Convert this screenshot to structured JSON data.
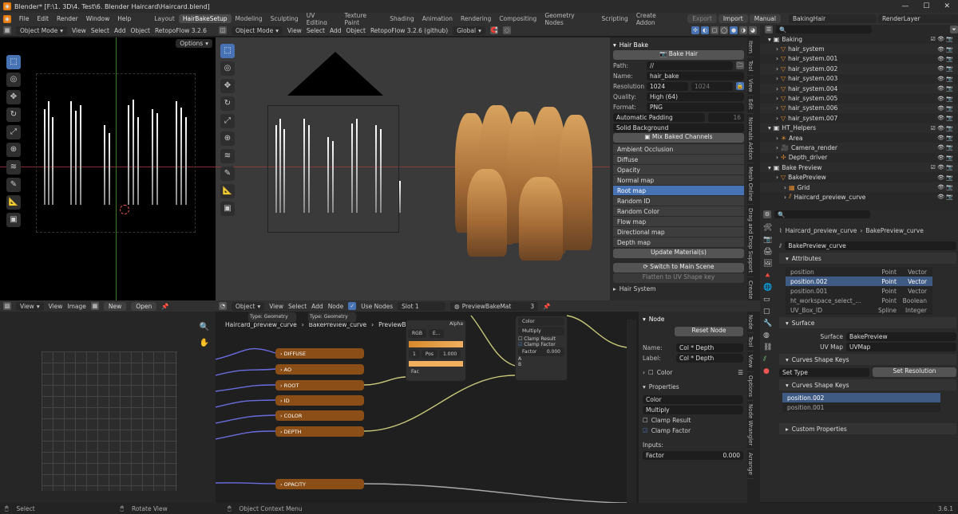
{
  "titlebar": {
    "title": "Blender* [F:\\1. 3D\\4. Test\\6. Blender Haircard\\Haircard.blend]"
  },
  "menu": {
    "items": [
      "File",
      "Edit",
      "Render",
      "Window",
      "Help"
    ],
    "workspaces": [
      "Layout",
      "HairBakeSetup",
      "Modeling",
      "Sculpting",
      "UV Editing",
      "Texture Paint",
      "Shading",
      "Animation",
      "Rendering",
      "Compositing",
      "Geometry Nodes",
      "Scripting",
      "Create Addon"
    ],
    "active_workspace": "HairBakeSetup",
    "export": "Export",
    "import": "Import",
    "manual": "Manual",
    "scene": "BakingHair",
    "view_layer": "RenderLayer"
  },
  "uv_header": {
    "mode": "Object Mode",
    "view": "View",
    "select": "Select",
    "add": "Add",
    "object": "Object",
    "addon": "RetopoFlow 3.2.6",
    "options": "Options"
  },
  "v3d_header": {
    "mode": "Object Mode",
    "view": "View",
    "select": "Select",
    "add": "Add",
    "object": "Object",
    "addon": "RetopoFlow 3.2.6 (github)",
    "orientation": "Global"
  },
  "hair_bake": {
    "panel_title": "Hair Bake",
    "bake_button": "Bake Hair",
    "path_label": "Path:",
    "path_value": "//",
    "name_label": "Name:",
    "name_value": "hair_bake",
    "resolution_label": "Resolution",
    "res_x": "1024",
    "res_y": "1024",
    "quality_label": "Quality:",
    "quality_value": "High (64)",
    "format_label": "Format:",
    "format_value": "PNG",
    "padding_label": "Automatic Padding",
    "padding_value": "16",
    "background": "Solid Background",
    "mix_button": "Mix Baked Channels",
    "channels": [
      "Ambient Occlusion",
      "Diffuse",
      "Opacity",
      "Normal map",
      "Root map",
      "Random ID",
      "Random Color",
      "Flow map",
      "Directional map",
      "Depth map"
    ],
    "selected_channel": "Root map",
    "update_button": "Update Material(s)",
    "switch_button": "Switch to Main Scene",
    "flatten_button": "Flatten to UV Shape key",
    "hair_system": "Hair System"
  },
  "side_tabs": [
    "Item",
    "Tool",
    "View",
    "Edit",
    "Normals Addon",
    "Mesh Online",
    "Drag and Drop Support",
    "Create"
  ],
  "node_side_tabs": [
    "Node",
    "Tool",
    "View",
    "Options",
    "Node Wrangler",
    "Arrange"
  ],
  "outliner": {
    "search_placeholder": "",
    "rows": [
      {
        "label": "Baking",
        "indent": 1,
        "kind": "collection"
      },
      {
        "label": "hair_system",
        "indent": 2,
        "kind": "object"
      },
      {
        "label": "hair_system.001",
        "indent": 2,
        "kind": "object"
      },
      {
        "label": "hair_system.002",
        "indent": 2,
        "kind": "object"
      },
      {
        "label": "hair_system.003",
        "indent": 2,
        "kind": "object"
      },
      {
        "label": "hair_system.004",
        "indent": 2,
        "kind": "object"
      },
      {
        "label": "hair_system.005",
        "indent": 2,
        "kind": "object"
      },
      {
        "label": "hair_system.006",
        "indent": 2,
        "kind": "object"
      },
      {
        "label": "hair_system.007",
        "indent": 2,
        "kind": "object"
      },
      {
        "label": "HT_Helpers",
        "indent": 1,
        "kind": "collection"
      },
      {
        "label": "Area",
        "indent": 2,
        "kind": "light"
      },
      {
        "label": "Camera_render",
        "indent": 2,
        "kind": "camera"
      },
      {
        "label": "Depth_driver",
        "indent": 2,
        "kind": "empty"
      },
      {
        "label": "Bake Preview",
        "indent": 1,
        "kind": "collection"
      },
      {
        "label": "BakePreview",
        "indent": 2,
        "kind": "object"
      },
      {
        "label": "Grid",
        "indent": 3,
        "kind": "mesh"
      },
      {
        "label": "Haircard_preview_curve",
        "indent": 3,
        "kind": "curve"
      }
    ]
  },
  "properties": {
    "breadcrumb_obj": "Haircard_preview_curve",
    "breadcrumb_data": "BakePreview_curve",
    "data_name": "BakePreview_curve",
    "attributes_title": "Attributes",
    "attributes": [
      {
        "name": "position",
        "domain": "Point",
        "type": "Vector"
      },
      {
        "name": "position.002",
        "domain": "Point",
        "type": "Vector"
      },
      {
        "name": "position.001",
        "domain": "Point",
        "type": "Vector"
      },
      {
        "name": "ht_workspace_select_...",
        "domain": "Point",
        "type": "Boolean"
      },
      {
        "name": "UV_Box_ID",
        "domain": "Spline",
        "type": "Integer"
      }
    ],
    "surface_title": "Surface",
    "surface_label": "Surface",
    "surface_value": "BakePreview",
    "uvmap_label": "UV Map",
    "uvmap_value": "UVMap",
    "shape_keys_title": "Curves Shape Keys",
    "set_type": "Set Type",
    "set_resolution": "Set Resolution",
    "shape_keys_title2": "Curves Shape Keys",
    "shape_keys": [
      "position.002",
      "position.001"
    ],
    "custom_props": "Custom Properties"
  },
  "image_editor": {
    "view": "View",
    "view2": "View",
    "image": "Image",
    "new": "New",
    "open": "Open"
  },
  "node_header": {
    "object": "Object",
    "view": "View",
    "select": "Select",
    "add": "Add",
    "node": "Node",
    "use_nodes": "Use Nodes",
    "slot": "Slot 1",
    "material": "PreviewBakeMat",
    "users": "3"
  },
  "node_breadcrumb": [
    "Haircard_preview_curve",
    "BakePreview_curve",
    "PreviewBakeMat"
  ],
  "nodes": {
    "attr_nodes": [
      "DIFFUSE",
      "AO",
      "ROOT",
      "ID",
      "COLOR",
      "DEPTH",
      "OPACITY"
    ],
    "type_label": "Type:",
    "type_value": "Geometry",
    "alpha": "Alpha",
    "ramp_mode": "RGB",
    "ramp_interp": "E...",
    "ramp_index": "1",
    "ramp_pos_label": "Pos",
    "ramp_pos": "1.000",
    "fac": "Fac",
    "mix_color": "Color",
    "mix_blend": "Multiply",
    "clamp_result": "Clamp Result",
    "clamp_factor": "Clamp Factor",
    "factor_label": "Factor",
    "factor_value": "0.000",
    "in_a": "A",
    "in_b": "B"
  },
  "node_panel": {
    "node_title": "Node",
    "reset": "Reset Node",
    "name_label": "Name:",
    "name_value": "Col * Depth",
    "label_label": "Label:",
    "label_value": "Col * Depth",
    "color": "Color",
    "properties_title": "Properties",
    "prop_color": "Color",
    "prop_blend": "Multiply",
    "clamp_result": "Clamp Result",
    "clamp_factor": "Clamp Factor",
    "inputs": "Inputs:",
    "factor_label": "Factor",
    "factor_value": "0.000"
  },
  "status": {
    "select": "Select",
    "rotate": "Rotate View",
    "context": "Object Context Menu",
    "version": "3.6.1"
  },
  "colors": {
    "accent": "#4772b3",
    "node_orange": "#8a4e16",
    "hair": "#d8a25e"
  }
}
